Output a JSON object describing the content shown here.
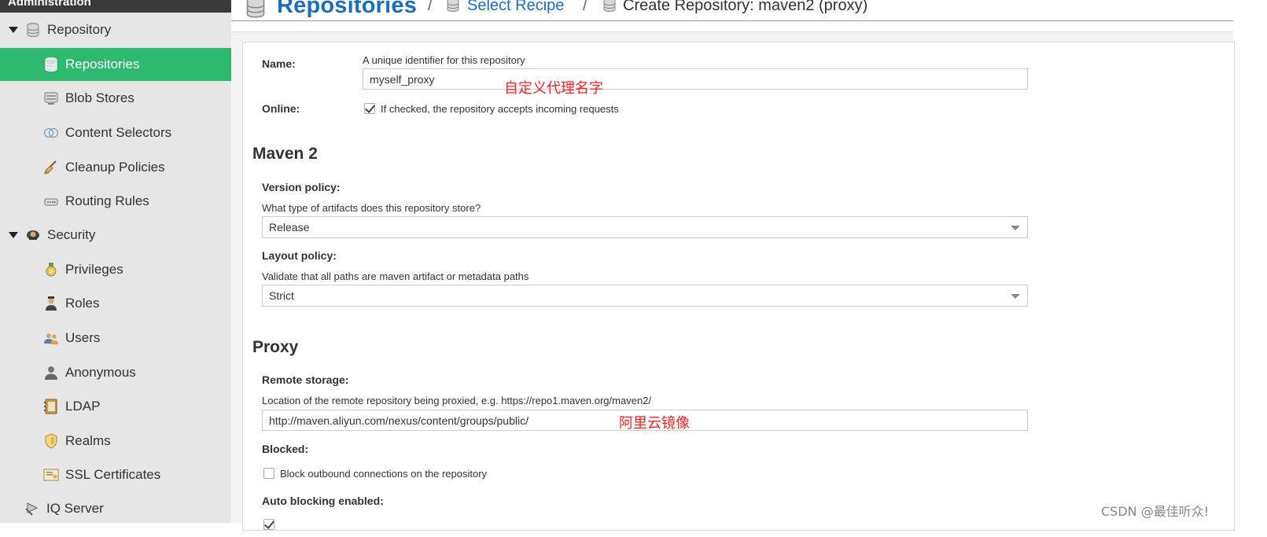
{
  "sidebar": {
    "header": "Administration",
    "groups": {
      "repository": "Repository",
      "security": "Security",
      "iq_server": "IQ Server"
    },
    "items": {
      "repositories": "Repositories",
      "blob_stores": "Blob Stores",
      "content_selectors": "Content Selectors",
      "cleanup_policies": "Cleanup Policies",
      "routing_rules": "Routing Rules",
      "privileges": "Privileges",
      "roles": "Roles",
      "users": "Users",
      "anonymous": "Anonymous",
      "ldap": "LDAP",
      "realms": "Realms",
      "ssl_certificates": "SSL Certificates"
    }
  },
  "header": {
    "title": "Repositories",
    "sep": "/",
    "select_recipe": "Select Recipe",
    "current": "Create Repository: maven2 (proxy)"
  },
  "form": {
    "name_label": "Name:",
    "name_help": "A unique identifier for this repository",
    "name_value": "myself_proxy",
    "online_label": "Online:",
    "online_help": "If checked, the repository accepts incoming requests",
    "online_checked": true,
    "maven_section": "Maven 2",
    "version_policy_label": "Version policy:",
    "version_policy_help": "What type of artifacts does this repository store?",
    "version_policy_value": "Release",
    "layout_policy_label": "Layout policy:",
    "layout_policy_help": "Validate that all paths are maven artifact or metadata paths",
    "layout_policy_value": "Strict",
    "proxy_section": "Proxy",
    "remote_storage_label": "Remote storage:",
    "remote_storage_help": "Location of the remote repository being proxied, e.g. https://repo1.maven.org/maven2/",
    "remote_storage_value": "http://maven.aliyun.com/nexus/content/groups/public/",
    "blocked_label": "Blocked:",
    "blocked_help": "Block outbound connections on the repository",
    "blocked_checked": false,
    "auto_blocking_label": "Auto blocking enabled:"
  },
  "annotations": {
    "name_note": "自定义代理名字",
    "remote_note": "阿里云镜像"
  },
  "watermark": "CSDN @最佳听众!",
  "colors": {
    "active_nav": "#2dba6f",
    "link": "#1a6ec2",
    "annotation": "#ff2020"
  }
}
